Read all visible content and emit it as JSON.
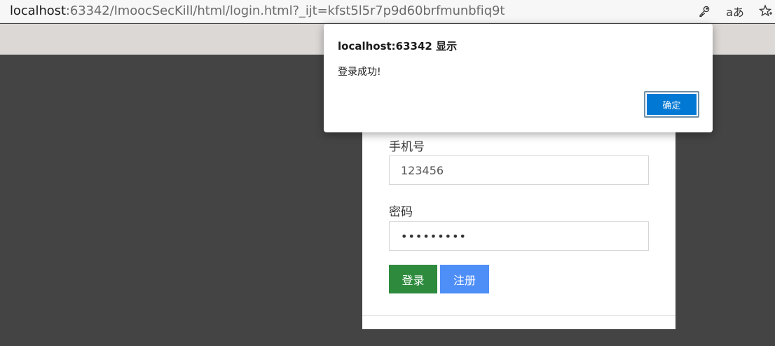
{
  "browser": {
    "url_host": "localhost",
    "url_rest": ":63342/ImoocSecKill/html/login.html?_ijt=kfst5l5r7p9d60brfmunbfiq9t",
    "icons": [
      "key-icon",
      "read-aloud-icon",
      "favorite-add-icon"
    ],
    "read_aloud_glyph": "aあ"
  },
  "form": {
    "phone_label": "手机号",
    "phone_value": "123456",
    "password_label": "密码",
    "password_value": "•••••••••",
    "login_button": "登录",
    "register_button": "注册"
  },
  "dialog": {
    "title": "localhost:63342 显示",
    "message": "登录成功!",
    "ok_button": "确定"
  },
  "colors": {
    "login_button": "#2e8b3e",
    "register_button": "#4e8ef7",
    "dialog_ok": "#0078d4",
    "overlay": "#444444"
  }
}
